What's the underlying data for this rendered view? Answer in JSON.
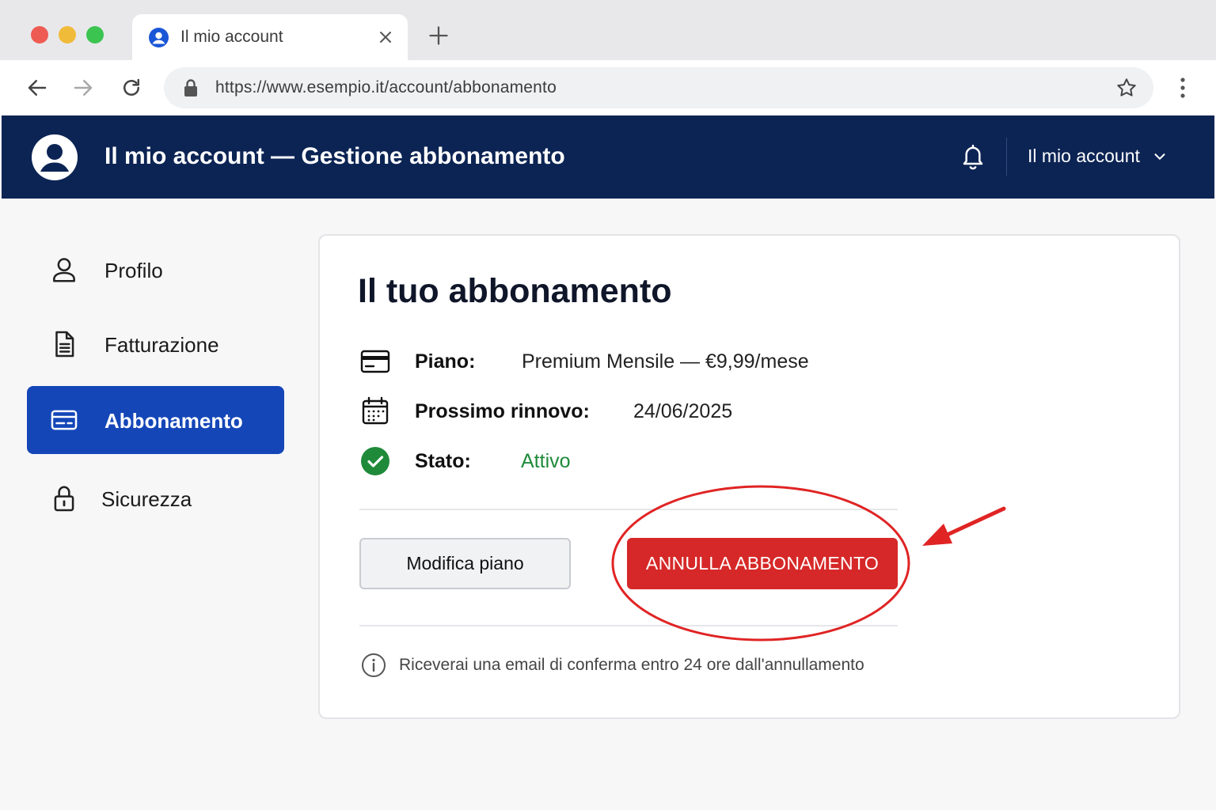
{
  "browser": {
    "tab_title": "Il mio account",
    "url": "https://www.esempio.it/account/abbonamento"
  },
  "header": {
    "title": "Il mio account — Gestione abbonamento",
    "account_menu_label": "Il mio account"
  },
  "sidebar": {
    "items": [
      {
        "label": "Profilo",
        "icon": "user-icon",
        "active": false
      },
      {
        "label": "Fatturazione",
        "icon": "document-icon",
        "active": false
      },
      {
        "label": "Abbonamento",
        "icon": "card-icon",
        "active": true
      },
      {
        "label": "Sicurezza",
        "icon": "lock-icon",
        "active": false
      }
    ]
  },
  "subscription": {
    "title": "Il tuo abbonamento",
    "plan_label": "Piano:",
    "plan_value": "Premium Mensile — €9,99/mese",
    "renewal_label": "Prossimo rinnovo:",
    "renewal_value": "24/06/2025",
    "status_label": "Stato:",
    "status_value": "Attivo",
    "modify_button": "Modifica piano",
    "cancel_button": "ANNULLA ABBONAMENTO",
    "info_text": "Riceverai una email di conferma entro 24 ore dall'annullamento"
  },
  "colors": {
    "header_bg": "#0c2454",
    "active_nav": "#1446b8",
    "cancel_button": "#d62828",
    "status_active": "#1f8a3a",
    "annotation": "#e02424"
  }
}
